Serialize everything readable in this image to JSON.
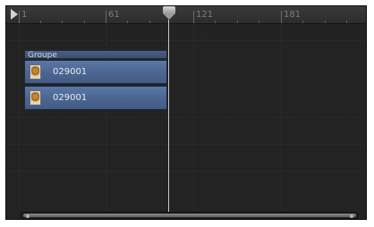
{
  "ruler": {
    "labels": [
      "1",
      "61",
      "121",
      "181"
    ]
  },
  "timeline": {
    "group": {
      "label": "Groupe"
    },
    "clips": [
      {
        "name": "029001",
        "thumbnail": "clip-thumbnail-icon"
      },
      {
        "name": "029001",
        "thumbnail": "clip-thumbnail-icon"
      }
    ]
  },
  "colors": {
    "background": "#232323",
    "clip": "#4a6590",
    "group_header": "#445a7c",
    "playhead": "#c8c8c8"
  }
}
